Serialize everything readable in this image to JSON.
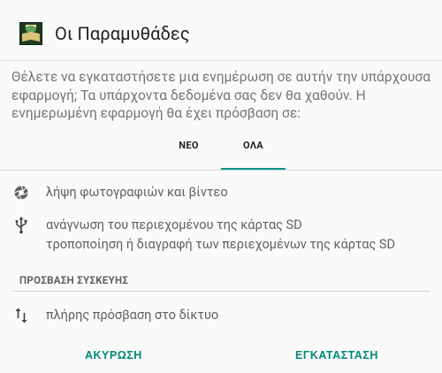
{
  "dialog": {
    "app_title": "Οι Παραμυθάδες",
    "message": "Θέλετε να εγκαταστήσετε μια ενημέρωση σε αυτήν την υπάρχουσα εφαρμογή; Τα υπάρχοντα δεδομένα σας δεν θα χαθούν. Η ενημερωμένη εφαρμογή θα έχει πρόσβαση σε:"
  },
  "tabs": [
    {
      "label": "ΝΕΟ",
      "selected": false
    },
    {
      "label": "ΟΛΑ",
      "selected": true
    }
  ],
  "permissions": [
    {
      "icon": "camera-icon",
      "lines": [
        "λήψη φωτογραφιών και βίντεο"
      ]
    },
    {
      "icon": "usb-icon",
      "lines": [
        "ανάγνωση του περιεχομένου της κάρτας SD",
        "τροποποίηση ή διαγραφή των περιεχομένων της κάρτας SD"
      ]
    }
  ],
  "device_access": {
    "header": "ΠΡΟΣΒΑΣΗ ΣΥΣΚΕΥΗΣ",
    "items": [
      {
        "icon": "network-arrows-icon",
        "label": "πλήρης πρόσβαση στο δίκτυο"
      }
    ]
  },
  "actions": {
    "cancel": "ΑΚΥΡΩΣΗ",
    "install": "ΕΓΚΑΤΑΣΤΑΣΗ"
  },
  "colors": {
    "accent": "#009688",
    "button_text": "#00897b",
    "background": "#fafafa"
  }
}
